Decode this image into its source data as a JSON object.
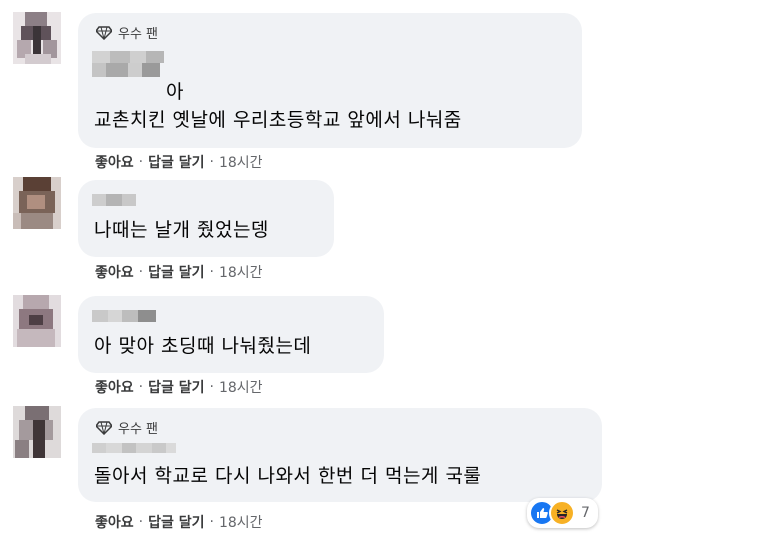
{
  "comments": [
    {
      "badge": "우수 팬",
      "author_tail": "아",
      "text": "교촌치킨 옛날에 우리초등학교 앞에서 나눠줌",
      "actions": {
        "like": "좋아요",
        "reply": "답글 달기",
        "time": "18시간"
      }
    },
    {
      "text": "나때는 날개 줬었는뎅",
      "actions": {
        "like": "좋아요",
        "reply": "답글 달기",
        "time": "18시간"
      }
    },
    {
      "text": "아 맞아 초딩때 나눠줬는데",
      "actions": {
        "like": "좋아요",
        "reply": "답글 달기",
        "time": "18시간"
      }
    },
    {
      "badge": "우수 팬",
      "text": "돌아서 학교로 다시 나와서 한번 더 먹는게 국룰",
      "actions": {
        "like": "좋아요",
        "reply": "답글 달기",
        "time": "18시간"
      },
      "reactions": {
        "icons": [
          "like-icon",
          "haha-icon"
        ],
        "count": "7"
      }
    }
  ],
  "colors": {
    "bubble": "#f0f2f5",
    "meta": "#65676b",
    "like_blue": "#1877f2",
    "haha_yellow": "#f7b125"
  }
}
